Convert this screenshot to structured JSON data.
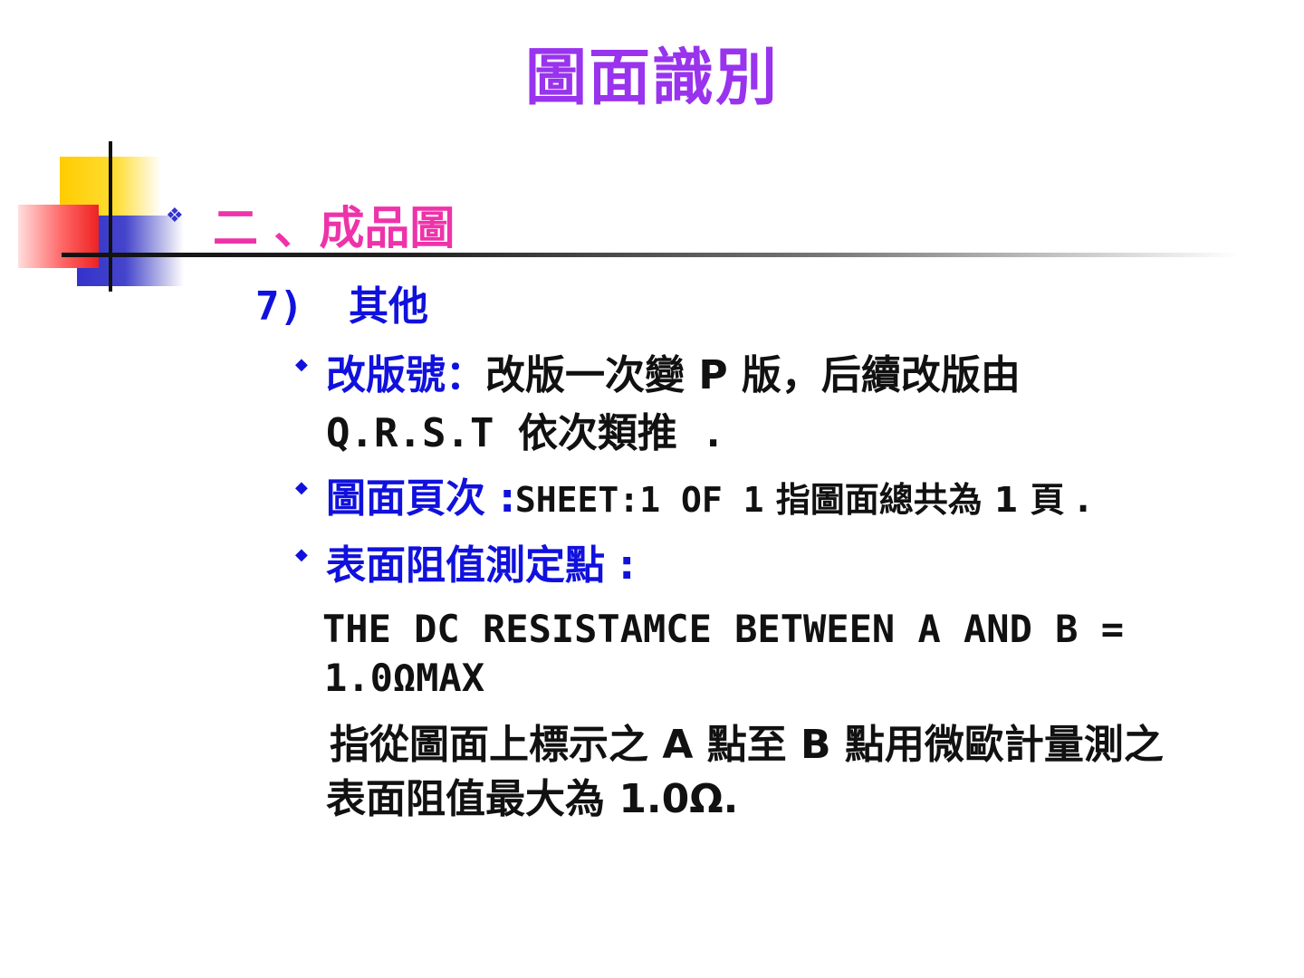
{
  "title": "圖面識別",
  "section": {
    "heading": "二 、成品圖"
  },
  "subsection": {
    "number": "7)",
    "label": "其他"
  },
  "items": [
    {
      "label": "改版號：",
      "text_line1": "改版一次變 P 版，后續改版由",
      "text_line2": "Q.R.S.T 依次類推 ."
    },
    {
      "label": "圖面頁次 :",
      "text_mono": "SHEET:1 OF 1",
      "text_rest": "指圖面總共為 1 頁 ."
    },
    {
      "label": "表面阻值測定點 :"
    }
  ],
  "spec": {
    "line1": "THE DC RESISTAMCE BETWEEN A AND B =",
    "line2": "1.0ΩMAX",
    "desc_line1": "指從圖面上標示之 A 點至 B 點用微歐計量測之",
    "desc_line2": "表面阻值最大為 1.0Ω."
  },
  "colors": {
    "title": "#9933ee",
    "heading": "#ee33aa",
    "label_blue": "#1111dd",
    "body_text": "#111111"
  }
}
